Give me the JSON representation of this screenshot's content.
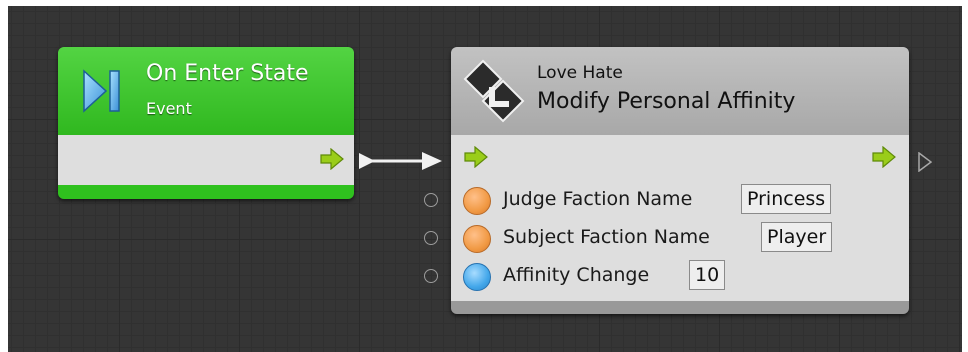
{
  "event_node": {
    "title": "On Enter State",
    "subtitle": "Event",
    "icon": "step-forward-icon"
  },
  "action_node": {
    "category": "Love Hate",
    "title": "Modify Personal Affinity",
    "icon": "love-hate-logo-icon",
    "params": [
      {
        "label": "Judge Faction Name",
        "value": "Princess",
        "type": "string",
        "color": "#f19a45"
      },
      {
        "label": "Subject Faction Name",
        "value": "Player",
        "type": "string",
        "color": "#f19a45"
      },
      {
        "label": "Affinity Change",
        "value": "10",
        "type": "number",
        "color": "#43a7ea"
      }
    ]
  },
  "colors": {
    "event_header": "#3fc52e",
    "flow_arrow": "#9acd1a",
    "canvas": "#353535"
  }
}
